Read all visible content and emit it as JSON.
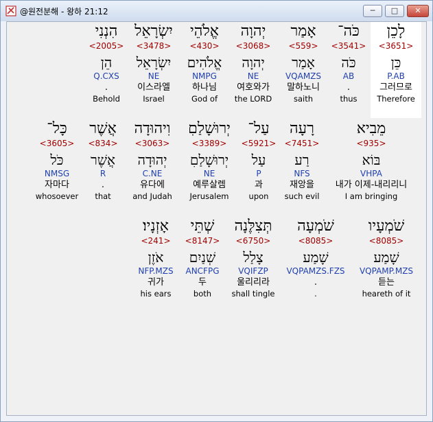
{
  "window": {
    "title": "@원전분해 - 왕하 21:12",
    "minimize_label": "─",
    "maximize_label": "□",
    "close_label": "✕"
  },
  "rows": [
    {
      "words": [
        {
          "hebrew": "לָכֵן",
          "strong": "<3651>",
          "root": "כֵּן",
          "morph": "P.AB",
          "korean": "그러므로",
          "english": "Therefore",
          "highlighted": true
        },
        {
          "hebrew": "כֹּה־",
          "strong": "<3541>",
          "root": "כֹּה",
          "morph": "AB",
          "korean": ".",
          "english": "thus"
        },
        {
          "hebrew": "אָמַר",
          "strong": "<559>",
          "root": "אָמַר",
          "morph": "VQAMZS",
          "korean": "말하노니",
          "english": "saith"
        },
        {
          "hebrew": "יְהוָה",
          "strong": "<3068>",
          "root": "יְהוָה",
          "morph": "NE",
          "korean": "여호와가",
          "english": "the LORD"
        },
        {
          "hebrew": "אֱלֹהֵי",
          "strong": "<430>",
          "root": "אֱלֹהִים",
          "morph": "NMPG",
          "korean": "하나님",
          "english": "God of"
        },
        {
          "hebrew": "יִשְׂרָאֵל",
          "strong": "<3478>",
          "root": "יִשְׂרָאֵל",
          "morph": "NE",
          "korean": "이스라엘",
          "english": "Israel"
        },
        {
          "hebrew": "הִנְנִי",
          "strong": "<2005>",
          "root": "הֵן",
          "morph": "Q.CXS",
          "korean": ".",
          "english": "Behold"
        }
      ]
    },
    {
      "words": [
        {
          "hebrew": "מֵבִיא",
          "strong": "<935>",
          "root": "בּוֹא",
          "morph": "VHPA",
          "korean": "내가 이제-내리리니",
          "english": "I am bringing"
        },
        {
          "hebrew": "רָעָה",
          "strong": "<7451>",
          "root": "רַע",
          "morph": "NFS",
          "korean": "재앙을",
          "english": "such evil"
        },
        {
          "hebrew": "עַל־",
          "strong": "<5921>",
          "root": "עַל",
          "morph": "P",
          "korean": "과",
          "english": "upon"
        },
        {
          "hebrew": "יְרוּשָׁלַםִ",
          "strong": "<3389>",
          "root": "יְרוּשָׁלַםִ",
          "morph": "NE",
          "korean": "예루살렘",
          "english": "Jerusalem"
        },
        {
          "hebrew": "וִיהוּדָה",
          "strong": "<3063>",
          "root": "יְהוּדָה",
          "morph": "C.NE",
          "korean": "유다에",
          "english": "and Judah"
        },
        {
          "hebrew": "אֲשֶׁר",
          "strong": "<834>",
          "root": "אֲשֶׁר",
          "morph": "R",
          "korean": ".",
          "english": "that"
        },
        {
          "hebrew": "כָּל־",
          "strong": "<3605>",
          "root": "כֹּל",
          "morph": "NMSG",
          "korean": "자마다",
          "english": "whosoever"
        }
      ]
    },
    {
      "words": [
        {
          "hebrew": "שֹׁמְעָיו",
          "strong": "<8085>",
          "root": "שָׁמַע",
          "morph": "VQPAMP.MZS",
          "korean": "듣는",
          "english": "heareth of it"
        },
        {
          "hebrew": "שֹׁמְעָה",
          "strong": "<8085>",
          "root": "שָׁמַע",
          "morph": "VQPAMZS.FZS",
          "korean": ".",
          "english": "."
        },
        {
          "hebrew": "תְּצִלֶּנָה",
          "strong": "<6750>",
          "root": "צָלַל",
          "morph": "VQIFZP",
          "korean": "울리리라",
          "english": "shall tingle"
        },
        {
          "hebrew": "שְׁתֵּי",
          "strong": "<8147>",
          "root": "שְׁנַיִם",
          "morph": "ANCFPG",
          "korean": "두",
          "english": "both"
        },
        {
          "hebrew": "אָזְנָיו׃",
          "strong": "<241>",
          "root": "אֹזֶן",
          "morph": "NFP.MZS",
          "korean": "귀가",
          "english": "his ears"
        }
      ]
    }
  ]
}
